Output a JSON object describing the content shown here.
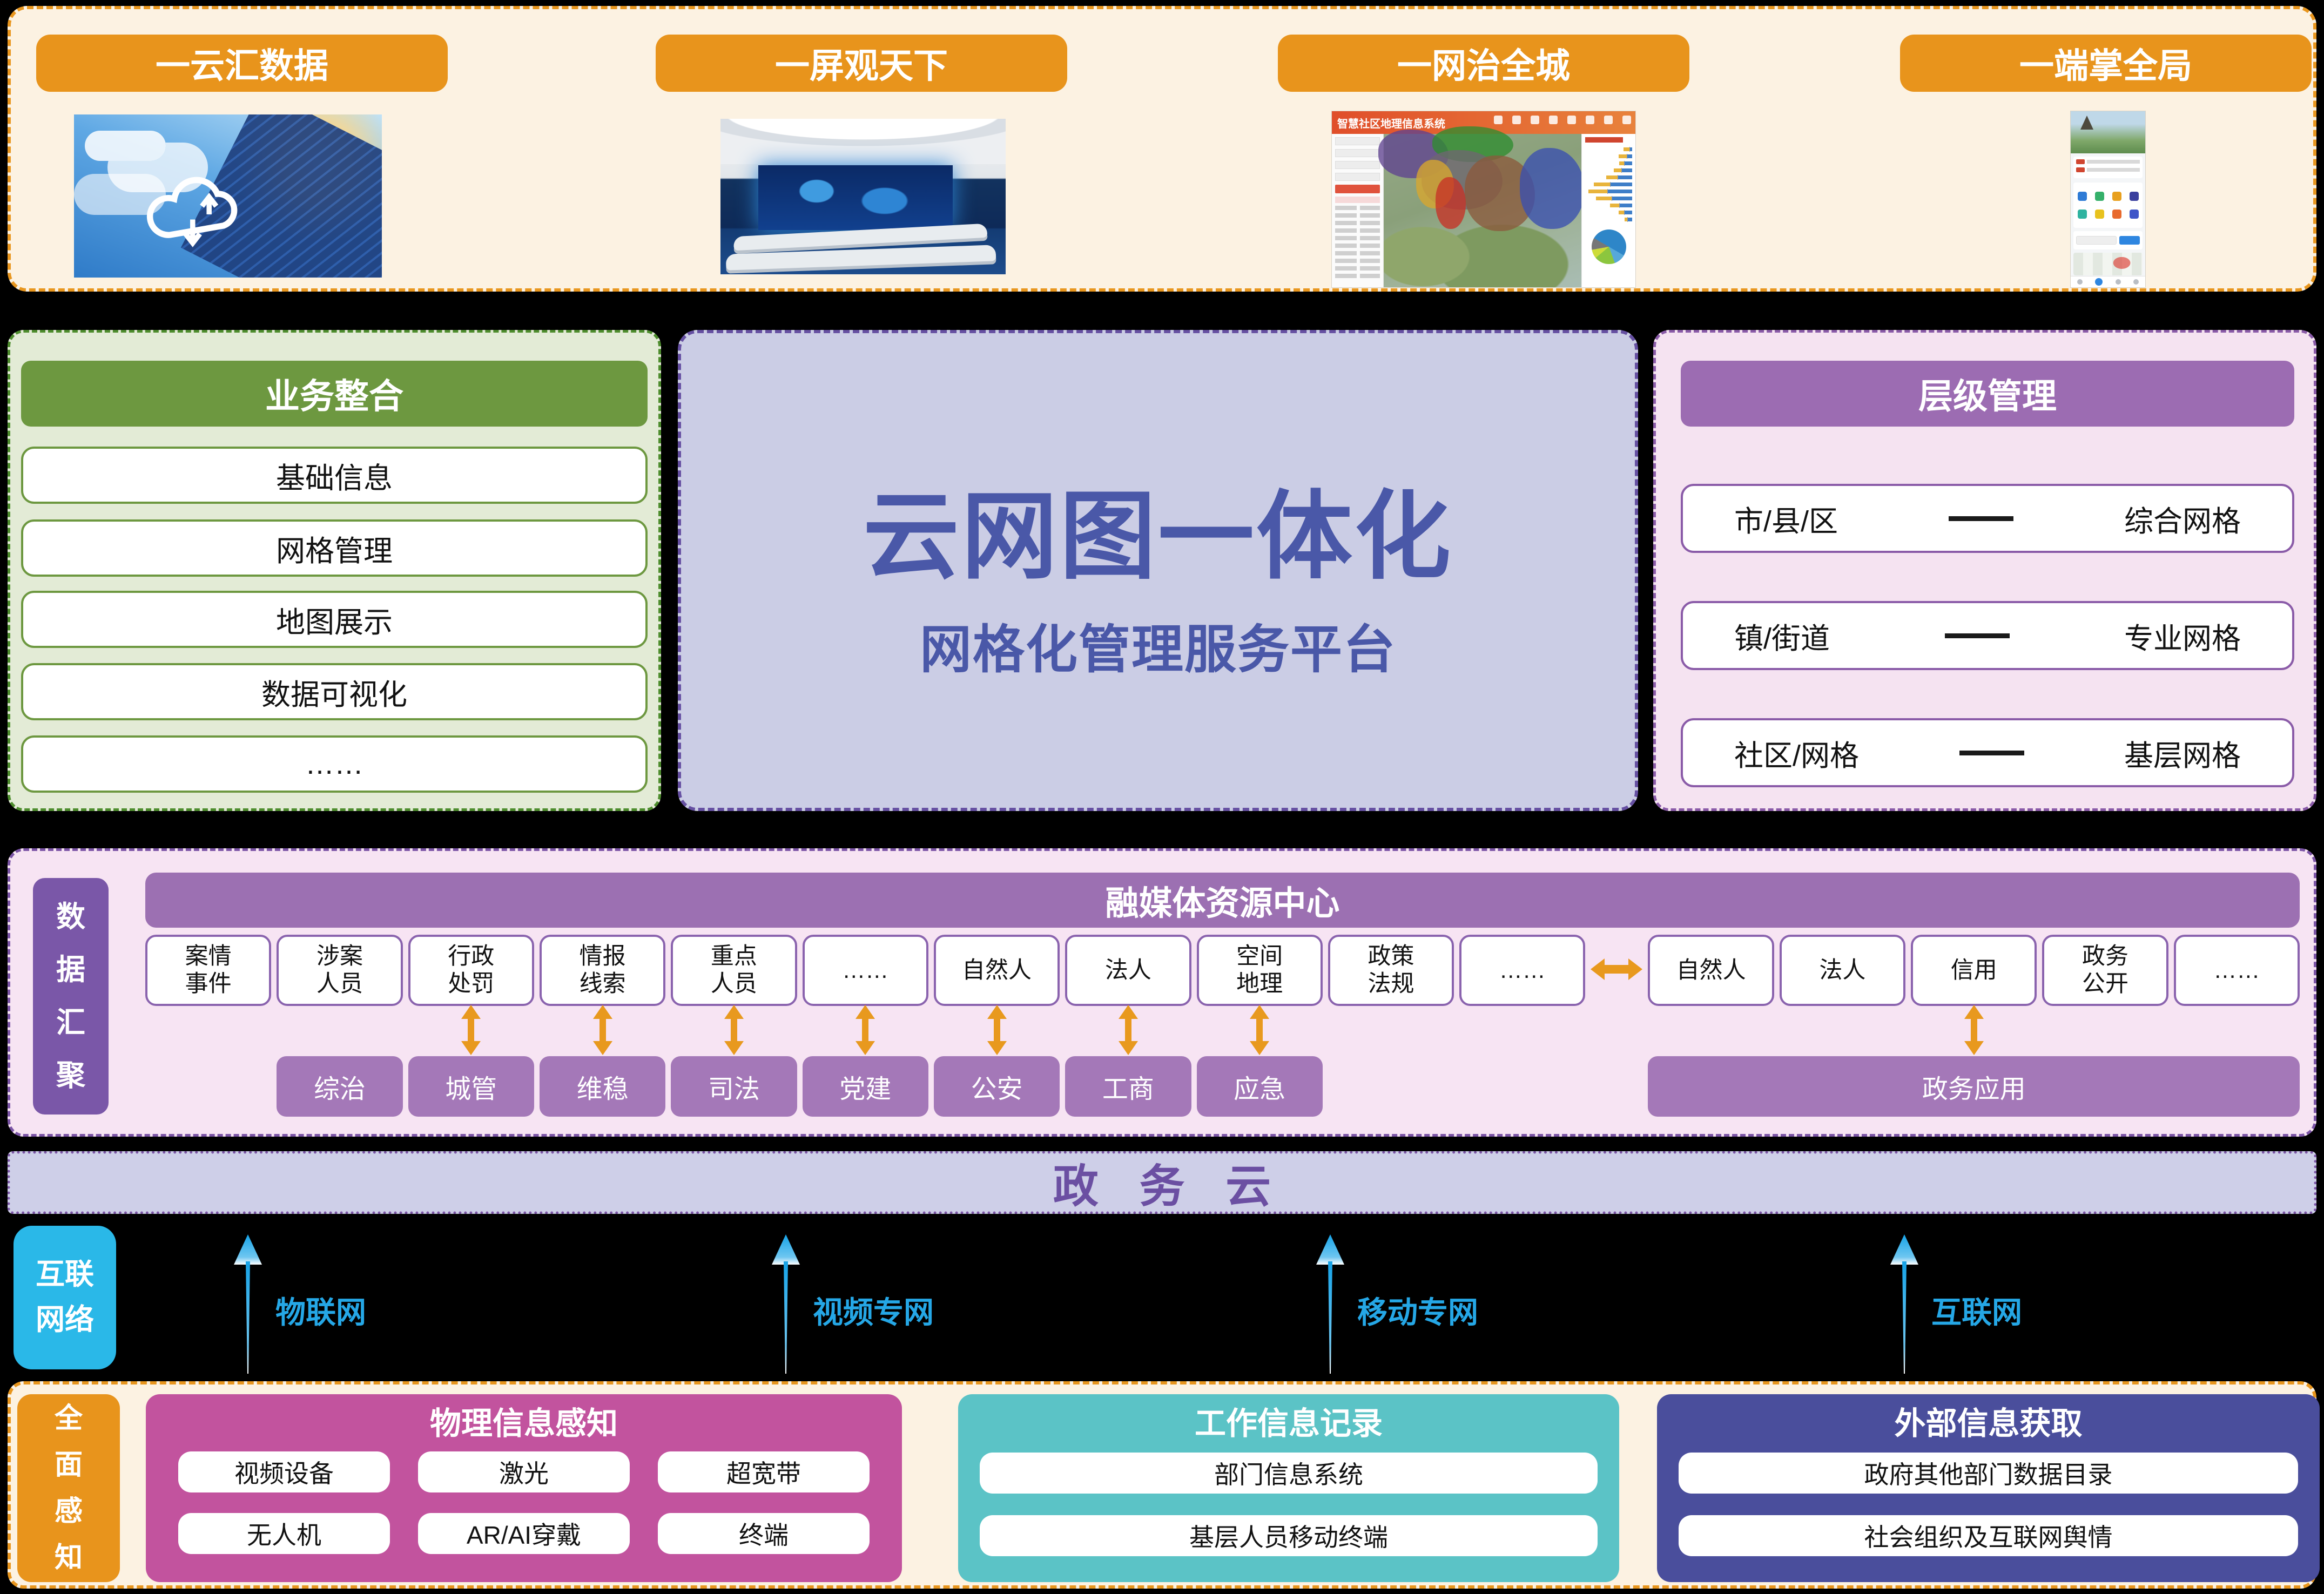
{
  "colors": {
    "orange": "#E8941C",
    "cream": "#FCF2E2",
    "green_header": "#6D9840",
    "green_border": "#4E8D2E",
    "lavender": "#CBCDE5",
    "title_blue": "#4A58A8",
    "purple_header": "#9C70B2",
    "purple_box": "#A478B8",
    "pink_bg": "#F7E4F3",
    "arrow_orange": "#E8991E",
    "cloud_bar_bg": "#CECFE8",
    "cloud_text": "#6B4FA2",
    "cyan": "#2AB8E8",
    "net_label": "#25A7E6",
    "magenta": "#C2539E",
    "teal": "#5BC3C6",
    "indigo": "#4A4E9C"
  },
  "top": {
    "buttons": [
      "一云汇数据",
      "一屏观天下",
      "一网治全城",
      "一端掌全局"
    ],
    "gis_thumb": {
      "title": "智慧社区地理信息系统",
      "pyramid": [
        [
          12,
          5
        ],
        [
          18,
          10
        ],
        [
          10,
          16
        ],
        [
          16,
          22
        ],
        [
          24,
          30
        ],
        [
          34,
          46
        ],
        [
          40,
          52
        ],
        [
          34,
          42
        ],
        [
          20,
          26
        ],
        [
          12,
          16
        ],
        [
          6,
          9
        ]
      ]
    },
    "phone_thumb": {
      "icon_colors": [
        "#2E7BD6",
        "#35B06A",
        "#E8A01E",
        "#3A3F9E",
        "#2FB3A0",
        "#E8C21E",
        "#E86A2E",
        "#3E55C8"
      ]
    }
  },
  "business": {
    "title": "业务整合",
    "items": [
      "基础信息",
      "网格管理",
      "地图展示",
      "数据可视化",
      "……"
    ]
  },
  "platform": {
    "title": "云网图一体化",
    "subtitle": "网格化管理服务平台"
  },
  "hierarchy": {
    "title": "层级管理",
    "rows": [
      {
        "left": "市/县/区",
        "right": "综合网格"
      },
      {
        "left": "镇/街道",
        "right": "专业网格"
      },
      {
        "left": "社区/网格",
        "right": "基层网格"
      }
    ]
  },
  "data_hub": {
    "tab": "数\n据\n汇\n聚",
    "header": "融媒体资源中心",
    "left_boxes": [
      "案情\n事件",
      "涉案\n人员",
      "行政\n处罚",
      "情报\n线索",
      "重点\n人员",
      "……",
      "自然人",
      "法人",
      "空间\n地理",
      "政策\n法规",
      "……"
    ],
    "right_boxes": [
      "自然人",
      "法人",
      "信用",
      "政务\n公开",
      "……"
    ],
    "dept_boxes": [
      "综治",
      "城管",
      "维稳",
      "司法",
      "党建",
      "公安",
      "工商",
      "应急"
    ],
    "gov_app": "政务应用"
  },
  "cloud_bar": {
    "label": "政务云"
  },
  "network": {
    "tab": "互联\n网络",
    "links": [
      "物联网",
      "视频专网",
      "移动专网",
      "互联网"
    ]
  },
  "sensing": {
    "tab": "全\n面\n感\n知",
    "physical": {
      "title": "物理信息感知",
      "items": [
        "视频设备",
        "激光",
        "超宽带",
        "无人机",
        "AR/AI穿戴",
        "终端"
      ]
    },
    "work": {
      "title": "工作信息记录",
      "items": [
        "部门信息系统",
        "基层人员移动终端"
      ]
    },
    "external": {
      "title": "外部信息获取",
      "items": [
        "政府其他部门数据目录",
        "社会组织及互联网舆情"
      ]
    }
  }
}
